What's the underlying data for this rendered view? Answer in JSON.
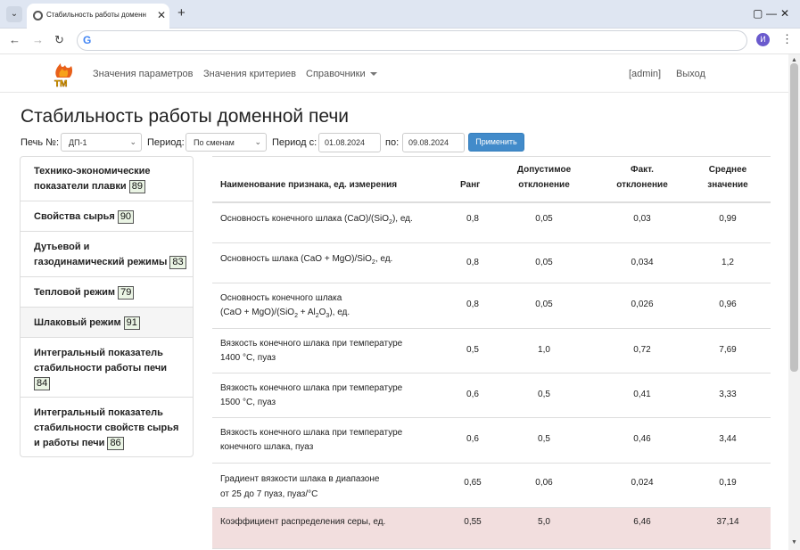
{
  "browser": {
    "tab_title": "Стабильность работы доменн",
    "close_glyph": "✕",
    "new_tab_glyph": "+",
    "menu_glyph": "⌄",
    "window_min": "—",
    "window_max": "▢",
    "window_close": "✕",
    "back_glyph": "←",
    "forward_glyph": "→",
    "reload_glyph": "↻",
    "google_glyph": "G",
    "profile_initial": "И",
    "kebab_glyph": "⋮",
    "url": ""
  },
  "navbar": {
    "links": [
      "Значения параметров",
      "Значения критериев",
      "Справочники"
    ],
    "user": "[admin]",
    "logout": "Выход"
  },
  "page_title": "Стабильность работы доменной печи",
  "filters": {
    "furnace_label": "Печь №:",
    "furnace_value": "ДП-1",
    "period_label": "Период:",
    "period_value": "По сменам",
    "from_label": "Период с:",
    "from_value": "01.08.2024",
    "to_label": "по:",
    "to_value": "09.08.2024",
    "apply_label": "Применить"
  },
  "sidebar": {
    "items": [
      {
        "lines": [
          "Технико-экономические",
          "показатели плавки"
        ],
        "badge": "89"
      },
      {
        "lines": [
          "Свойства сырья"
        ],
        "badge": "90"
      },
      {
        "lines": [
          "Дутьевой и",
          "газодинамический режимы"
        ],
        "badge": "83"
      },
      {
        "lines": [
          "Тепловой режим"
        ],
        "badge": "79"
      },
      {
        "lines": [
          "Шлаковый режим"
        ],
        "badge": "91"
      },
      {
        "lines": [
          "Интегральный показатель",
          "стабильности работы печи",
          ""
        ],
        "badge": "84"
      },
      {
        "lines": [
          "Интегральный показатель",
          "стабильности свойств сырья",
          "и работы печи"
        ],
        "badge": "86"
      }
    ]
  },
  "table": {
    "headers": {
      "name": "Наименование признака, ед. измерения",
      "rank": "Ранг",
      "allowed_1": "Допустимое",
      "allowed_2": "отклонение",
      "actual_1": "Факт.",
      "actual_2": "отклонение",
      "mean_1": "Среднее",
      "mean_2": "значение"
    },
    "rows": [
      {
        "name": "Основность конечного шлака (CaO)/(SiO₂), ед.",
        "rank": "0,8",
        "allowed": "0,05",
        "actual": "0,03",
        "mean": "0,99"
      },
      {
        "name": "Основность шлака (CaO + MgO)/SiO₂, ед.",
        "rank": "0,8",
        "allowed": "0,05",
        "actual": "0,034",
        "mean": "1,2"
      },
      {
        "name": "Основность конечного шлака (CaO + MgO)/(SiO₂ + Al₂O₃), ед.",
        "rank": "0,8",
        "allowed": "0,05",
        "actual": "0,026",
        "mean": "0,96"
      },
      {
        "name": "Вязкость конечного шлака при температуре 1400 °С, пуаз",
        "rank": "0,5",
        "allowed": "1,0",
        "actual": "0,72",
        "mean": "7,69"
      },
      {
        "name": "Вязкость конечного шлака при температуре 1500 °С, пуаз",
        "rank": "0,6",
        "allowed": "0,5",
        "actual": "0,41",
        "mean": "3,33"
      },
      {
        "name": "Вязкость конечного шлака при температуре конечного шлака, пуаз",
        "rank": "0,6",
        "allowed": "0,5",
        "actual": "0,46",
        "mean": "3,44"
      },
      {
        "name": "Градиент вязкости шлака в диапазоне от 25 до 7 пуаз, пуаз/°С",
        "rank": "0,65",
        "allowed": "0,06",
        "actual": "0,024",
        "mean": "0,19"
      },
      {
        "name": "Коэффициент распределения серы, ед.",
        "rank": "0,55",
        "allowed": "5,0",
        "actual": "6,46",
        "mean": "37,14"
      }
    ]
  }
}
